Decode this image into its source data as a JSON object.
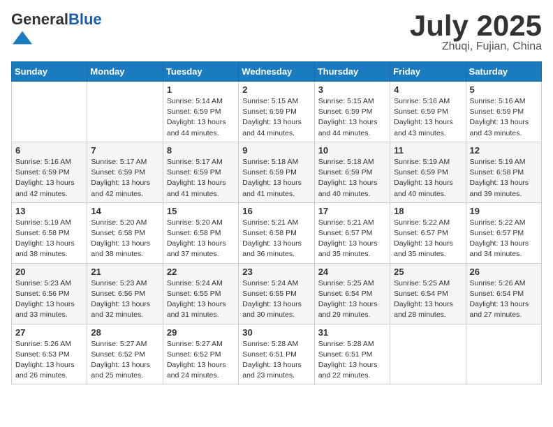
{
  "header": {
    "logo_general": "General",
    "logo_blue": "Blue",
    "month": "July 2025",
    "location": "Zhuqi, Fujian, China"
  },
  "days_of_week": [
    "Sunday",
    "Monday",
    "Tuesday",
    "Wednesday",
    "Thursday",
    "Friday",
    "Saturday"
  ],
  "weeks": [
    [
      {
        "day": "",
        "info": ""
      },
      {
        "day": "",
        "info": ""
      },
      {
        "day": "1",
        "sunrise": "5:14 AM",
        "sunset": "6:59 PM",
        "daylight": "13 hours and 44 minutes."
      },
      {
        "day": "2",
        "sunrise": "5:15 AM",
        "sunset": "6:59 PM",
        "daylight": "13 hours and 44 minutes."
      },
      {
        "day": "3",
        "sunrise": "5:15 AM",
        "sunset": "6:59 PM",
        "daylight": "13 hours and 44 minutes."
      },
      {
        "day": "4",
        "sunrise": "5:16 AM",
        "sunset": "6:59 PM",
        "daylight": "13 hours and 43 minutes."
      },
      {
        "day": "5",
        "sunrise": "5:16 AM",
        "sunset": "6:59 PM",
        "daylight": "13 hours and 43 minutes."
      }
    ],
    [
      {
        "day": "6",
        "sunrise": "5:16 AM",
        "sunset": "6:59 PM",
        "daylight": "13 hours and 42 minutes."
      },
      {
        "day": "7",
        "sunrise": "5:17 AM",
        "sunset": "6:59 PM",
        "daylight": "13 hours and 42 minutes."
      },
      {
        "day": "8",
        "sunrise": "5:17 AM",
        "sunset": "6:59 PM",
        "daylight": "13 hours and 41 minutes."
      },
      {
        "day": "9",
        "sunrise": "5:18 AM",
        "sunset": "6:59 PM",
        "daylight": "13 hours and 41 minutes."
      },
      {
        "day": "10",
        "sunrise": "5:18 AM",
        "sunset": "6:59 PM",
        "daylight": "13 hours and 40 minutes."
      },
      {
        "day": "11",
        "sunrise": "5:19 AM",
        "sunset": "6:59 PM",
        "daylight": "13 hours and 40 minutes."
      },
      {
        "day": "12",
        "sunrise": "5:19 AM",
        "sunset": "6:58 PM",
        "daylight": "13 hours and 39 minutes."
      }
    ],
    [
      {
        "day": "13",
        "sunrise": "5:19 AM",
        "sunset": "6:58 PM",
        "daylight": "13 hours and 38 minutes."
      },
      {
        "day": "14",
        "sunrise": "5:20 AM",
        "sunset": "6:58 PM",
        "daylight": "13 hours and 38 minutes."
      },
      {
        "day": "15",
        "sunrise": "5:20 AM",
        "sunset": "6:58 PM",
        "daylight": "13 hours and 37 minutes."
      },
      {
        "day": "16",
        "sunrise": "5:21 AM",
        "sunset": "6:58 PM",
        "daylight": "13 hours and 36 minutes."
      },
      {
        "day": "17",
        "sunrise": "5:21 AM",
        "sunset": "6:57 PM",
        "daylight": "13 hours and 35 minutes."
      },
      {
        "day": "18",
        "sunrise": "5:22 AM",
        "sunset": "6:57 PM",
        "daylight": "13 hours and 35 minutes."
      },
      {
        "day": "19",
        "sunrise": "5:22 AM",
        "sunset": "6:57 PM",
        "daylight": "13 hours and 34 minutes."
      }
    ],
    [
      {
        "day": "20",
        "sunrise": "5:23 AM",
        "sunset": "6:56 PM",
        "daylight": "13 hours and 33 minutes."
      },
      {
        "day": "21",
        "sunrise": "5:23 AM",
        "sunset": "6:56 PM",
        "daylight": "13 hours and 32 minutes."
      },
      {
        "day": "22",
        "sunrise": "5:24 AM",
        "sunset": "6:55 PM",
        "daylight": "13 hours and 31 minutes."
      },
      {
        "day": "23",
        "sunrise": "5:24 AM",
        "sunset": "6:55 PM",
        "daylight": "13 hours and 30 minutes."
      },
      {
        "day": "24",
        "sunrise": "5:25 AM",
        "sunset": "6:54 PM",
        "daylight": "13 hours and 29 minutes."
      },
      {
        "day": "25",
        "sunrise": "5:25 AM",
        "sunset": "6:54 PM",
        "daylight": "13 hours and 28 minutes."
      },
      {
        "day": "26",
        "sunrise": "5:26 AM",
        "sunset": "6:54 PM",
        "daylight": "13 hours and 27 minutes."
      }
    ],
    [
      {
        "day": "27",
        "sunrise": "5:26 AM",
        "sunset": "6:53 PM",
        "daylight": "13 hours and 26 minutes."
      },
      {
        "day": "28",
        "sunrise": "5:27 AM",
        "sunset": "6:52 PM",
        "daylight": "13 hours and 25 minutes."
      },
      {
        "day": "29",
        "sunrise": "5:27 AM",
        "sunset": "6:52 PM",
        "daylight": "13 hours and 24 minutes."
      },
      {
        "day": "30",
        "sunrise": "5:28 AM",
        "sunset": "6:51 PM",
        "daylight": "13 hours and 23 minutes."
      },
      {
        "day": "31",
        "sunrise": "5:28 AM",
        "sunset": "6:51 PM",
        "daylight": "13 hours and 22 minutes."
      },
      {
        "day": "",
        "info": ""
      },
      {
        "day": "",
        "info": ""
      }
    ]
  ],
  "labels": {
    "sunrise": "Sunrise:",
    "sunset": "Sunset:",
    "daylight": "Daylight:"
  }
}
